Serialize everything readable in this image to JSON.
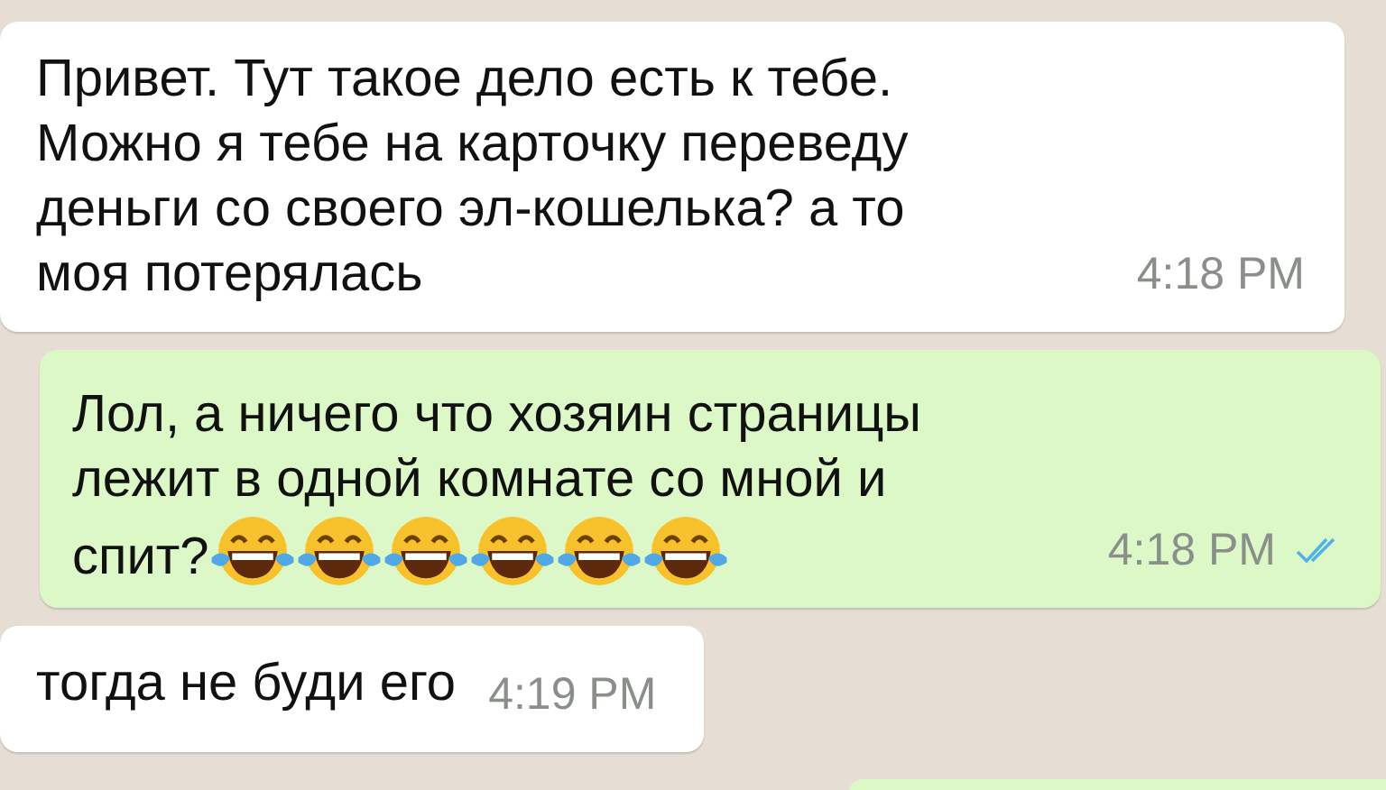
{
  "messages": [
    {
      "kind": "incoming",
      "lines": [
        "Привет. Тут такое дело есть к тебе.",
        "Можно я тебе на карточку переведу",
        "деньги со своего эл-кошелька? а то",
        "моя потерялась"
      ],
      "time": "4:18 PM"
    },
    {
      "kind": "outgoing",
      "lines": [
        "Лол, а ничего что хозяин страницы",
        "лежит в одной комнате со мной и",
        "спит?"
      ],
      "emoji": [
        {
          "kind": "tears-of-joy"
        },
        {
          "kind": "tears-of-joy"
        },
        {
          "kind": "tears-of-joy"
        },
        {
          "kind": "tears-of-joy"
        },
        {
          "kind": "tears-of-joy"
        },
        {
          "kind": "tears-of-joy"
        }
      ],
      "time": "4:18 PM",
      "read": true
    },
    {
      "kind": "incoming",
      "lines": [
        "тогда не буди его"
      ],
      "time": "4:19 PM"
    }
  ]
}
